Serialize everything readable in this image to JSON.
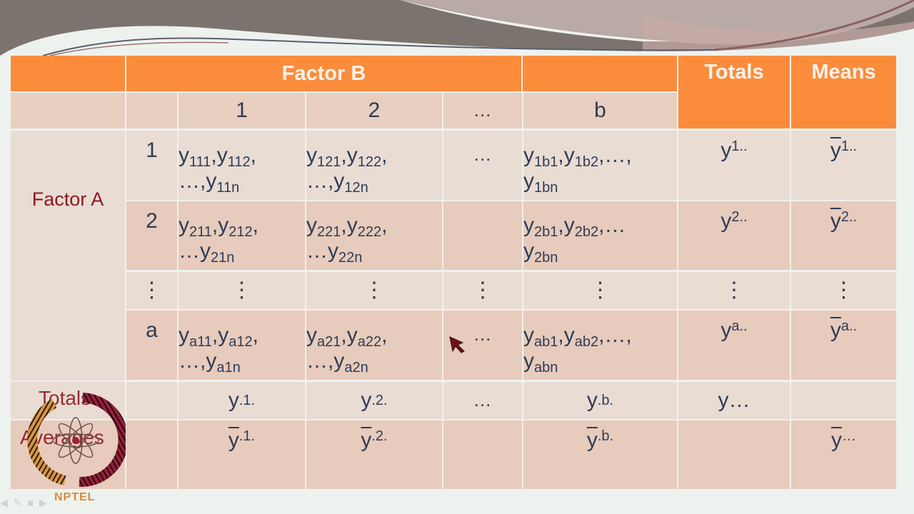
{
  "slide": {
    "header": {
      "factor_b": "Factor B",
      "totals": "Totals",
      "means": "Means",
      "levels_b": [
        "1",
        "2",
        "…",
        "b"
      ]
    },
    "row_label_group": "Factor A",
    "rows": [
      {
        "level": "1",
        "cells": [
          {
            "l1": "y<sub>111</sub>,y<sub>112</sub>,",
            "l2": "…,y<sub>11n</sub>"
          },
          {
            "l1": "y<sub>121</sub>,y<sub>122</sub>,",
            "l2": "…,y<sub>12n</sub>"
          },
          {
            "l1": "…",
            "l2": ""
          },
          {
            "l1": "y<sub>1b1</sub>,y<sub>1b2</sub>,…,",
            "l2": "y<sub>1bn</sub>"
          }
        ],
        "total": "y<sub>1..</sub>",
        "mean": "<span class='bar'>y</span><sub>1..</sub>"
      },
      {
        "level": "2",
        "cells": [
          {
            "l1": "y<sub>211</sub>,y<sub>212</sub>,",
            "l2": "…y<sub>21n</sub>"
          },
          {
            "l1": "y<sub>221</sub>,y<sub>222</sub>,",
            "l2": "…y<sub>22n</sub>"
          },
          {
            "l1": "",
            "l2": ""
          },
          {
            "l1": "y<sub>2b1</sub>,y<sub>2b2</sub>,…",
            "l2": "y<sub>2bn</sub>"
          }
        ],
        "total": "y<sub>2..</sub>",
        "mean": "<span class='bar'>y</span><sub>2..</sub>"
      },
      {
        "level": "⋮",
        "cells": [
          {
            "l1": "⋮",
            "l2": ""
          },
          {
            "l1": "⋮",
            "l2": ""
          },
          {
            "l1": "⋮",
            "l2": ""
          },
          {
            "l1": "⋮",
            "l2": ""
          }
        ],
        "total": "⋮",
        "mean": "⋮"
      },
      {
        "level": "a",
        "cells": [
          {
            "l1": "y<sub>a11</sub>,y<sub>a12</sub>,",
            "l2": "…,y<sub>a1n</sub>"
          },
          {
            "l1": "y<sub>a21</sub>,y<sub>a22</sub>,",
            "l2": "…,y<sub>a2n</sub>"
          },
          {
            "l1": "…",
            "l2": ""
          },
          {
            "l1": "y<sub>ab1</sub>,y<sub>ab2</sub>,…,",
            "l2": "y<sub>abn</sub>"
          }
        ],
        "total": "y<sub>a..</sub>",
        "mean": "<span class='bar'>y</span><sub>a..</sub>"
      }
    ],
    "totals_row": {
      "label": "Totals",
      "cells": [
        "y<sub>.1.</sub>",
        "y<sub>.2.</sub>",
        "…",
        "y<sub>.b.</sub>"
      ],
      "total": "y…",
      "mean": ""
    },
    "averages_row": {
      "label": "Averages",
      "cells": [
        "<span class='bar'>y</span><sub>.1.</sub>",
        "<span class='bar'>y</span><sub>.2.</sub>",
        "",
        "<span class='bar'>y</span><sub>.b.</sub>"
      ],
      "total": "",
      "mean": "<span class='bar'>y</span><sub>…</sub>"
    },
    "logo_text": "NPTEL",
    "colors": {
      "header_orange": "#fb8c3c",
      "row_light": "#e9dcd3",
      "row_dark": "#e7cbbc",
      "label_red": "#8b1a23",
      "text_navy": "#2e3b55"
    }
  }
}
